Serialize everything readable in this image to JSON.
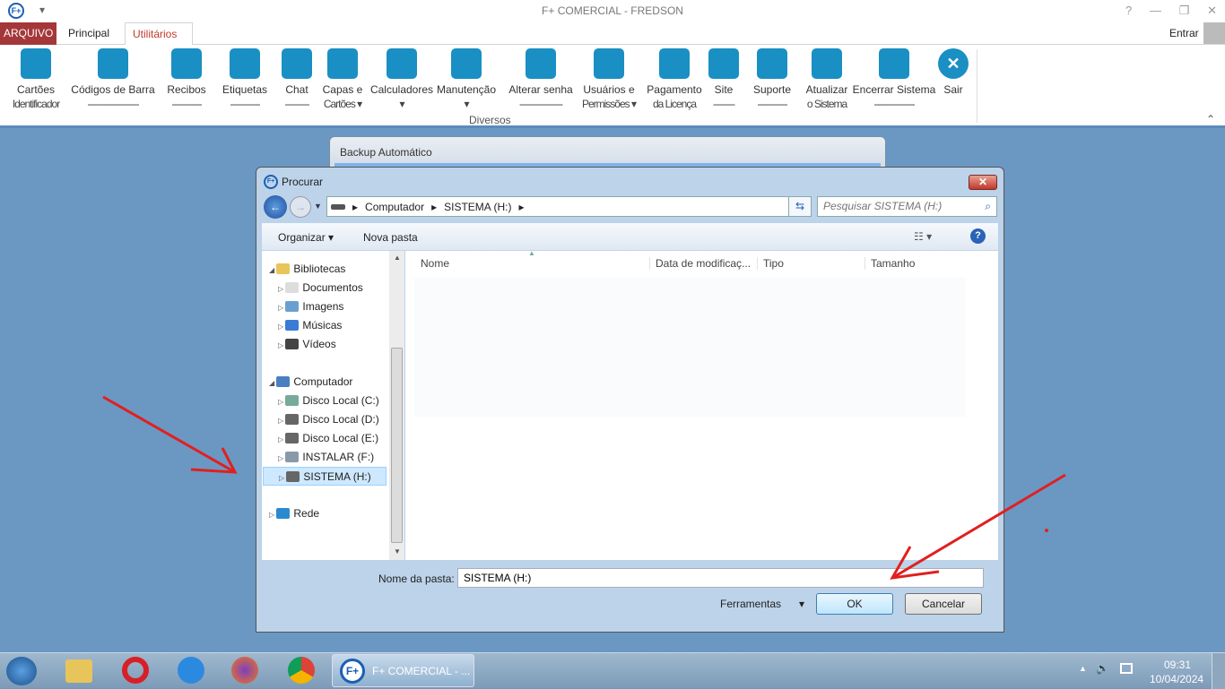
{
  "app": {
    "title": "F+ COMERCIAL - FREDSON",
    "login": "Entrar",
    "window_controls": [
      "?",
      "—",
      "❐",
      "✕"
    ]
  },
  "tabs": [
    {
      "label": "ARQUIVO"
    },
    {
      "label": "Principal"
    },
    {
      "label": "Utilitários",
      "active": true
    }
  ],
  "ribbon": {
    "group_label": "Diversos",
    "items": [
      {
        "l1": "Cartões",
        "l2": "Identificador",
        "icon": "card-icon"
      },
      {
        "l1": "Códigos de Barra",
        "l2": "-------------------",
        "icon": "barcode-icon"
      },
      {
        "l1": "Recibos",
        "l2": "-----------",
        "icon": "receipt-icon"
      },
      {
        "l1": "Etiquetas",
        "l2": "-----------",
        "icon": "tag-icon"
      },
      {
        "l1": "Chat",
        "l2": "---------",
        "icon": "chat-icon"
      },
      {
        "l1": "Capas e",
        "l2": "Cartões ▾",
        "icon": "covers-icon"
      },
      {
        "l1": "Calculadores",
        "l2": "▾",
        "icon": "calculator-icon"
      },
      {
        "l1": "Manutenção",
        "l2": "▾",
        "icon": "maintenance-icon"
      },
      {
        "l1": "Alterar senha",
        "l2": "----------------",
        "icon": "lock-icon"
      },
      {
        "l1": "Usuários e",
        "l2": "Permissões ▾",
        "icon": "users-icon"
      },
      {
        "l1": "Pagamento",
        "l2": "da Licença",
        "icon": "payment-icon"
      },
      {
        "l1": "Site",
        "l2": "--------",
        "icon": "home-icon"
      },
      {
        "l1": "Suporte",
        "l2": "-----------",
        "icon": "headset-icon"
      },
      {
        "l1": "Atualizar",
        "l2": "o Sistema",
        "icon": "globe-icon"
      },
      {
        "l1": "Encerrar Sistema",
        "l2": "---------------",
        "icon": "exit-icon"
      },
      {
        "l1": "Sair",
        "l2": "",
        "icon": "close-circle-icon"
      }
    ]
  },
  "background_window": {
    "title": "Backup Automático"
  },
  "dialog": {
    "title": "Procurar",
    "breadcrumb": [
      "Computador",
      "SISTEMA (H:)"
    ],
    "search_placeholder": "Pesquisar SISTEMA (H:)",
    "toolbar": {
      "organize": "Organizar",
      "new_folder": "Nova pasta"
    },
    "columns": [
      "Nome",
      "Data de modificaç...",
      "Tipo",
      "Tamanho"
    ],
    "tree": [
      {
        "label": "Bibliotecas",
        "level": 0,
        "expanded": true,
        "icon": "libraries-icon"
      },
      {
        "label": "Documentos",
        "level": 1,
        "icon": "document-icon"
      },
      {
        "label": "Imagens",
        "level": 1,
        "icon": "image-icon"
      },
      {
        "label": "Músicas",
        "level": 1,
        "icon": "music-icon"
      },
      {
        "label": "Vídeos",
        "level": 1,
        "icon": "video-icon"
      },
      {
        "label": "Computador",
        "level": 0,
        "expanded": true,
        "icon": "computer-icon"
      },
      {
        "label": "Disco Local (C:)",
        "level": 1,
        "icon": "windows-drive-icon"
      },
      {
        "label": "Disco Local (D:)",
        "level": 1,
        "icon": "drive-icon"
      },
      {
        "label": "Disco Local (E:)",
        "level": 1,
        "icon": "drive-icon"
      },
      {
        "label": "INSTALAR (F:)",
        "level": 1,
        "icon": "setup-drive-icon"
      },
      {
        "label": "SISTEMA (H:)",
        "level": 1,
        "selected": true,
        "icon": "drive-icon"
      },
      {
        "label": "Rede",
        "level": 0,
        "icon": "network-icon"
      }
    ],
    "folder_label": "Nome da pasta:",
    "folder_value": "SISTEMA (H:)",
    "tools": "Ferramentas",
    "ok": "OK",
    "cancel": "Cancelar"
  },
  "taskbar": {
    "active_app": "F+ COMERCIAL - ...",
    "time": "09:31",
    "date": "10/04/2024",
    "pinned": [
      "windows-start-icon",
      "explorer-icon",
      "opera-icon",
      "ie-icon",
      "firefox-icon",
      "chrome-icon"
    ]
  },
  "colors": {
    "arquivo_tab": "#a4373a",
    "accent_tab": "#c0392b",
    "ribbon_icon": "#1a8fc4",
    "desktop": "#6a98c3",
    "annotation": "#e02020"
  }
}
